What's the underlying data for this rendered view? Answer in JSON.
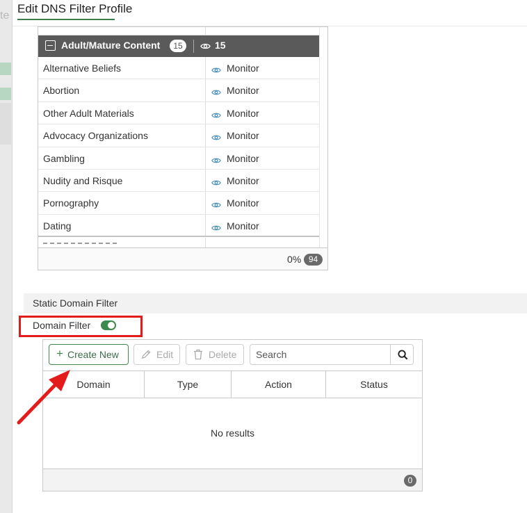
{
  "page": {
    "title": "Edit DNS Filter Profile"
  },
  "background": {
    "left_fragment": "te"
  },
  "category_table": {
    "group": {
      "label": "Adult/Mature Content",
      "badge": "15",
      "monitor_count": "15"
    },
    "rows": [
      {
        "name": "Alternative Beliefs",
        "action": "Monitor"
      },
      {
        "name": "Abortion",
        "action": "Monitor"
      },
      {
        "name": "Other Adult Materials",
        "action": "Monitor"
      },
      {
        "name": "Advocacy Organizations",
        "action": "Monitor"
      },
      {
        "name": "Gambling",
        "action": "Monitor"
      },
      {
        "name": "Nudity and Risque",
        "action": "Monitor"
      },
      {
        "name": "Pornography",
        "action": "Monitor"
      },
      {
        "name": "Dating",
        "action": "Monitor"
      }
    ],
    "footer": {
      "percent": "0%",
      "total": "94"
    }
  },
  "static_domain_filter": {
    "section_title": "Static Domain Filter",
    "toggle_label": "Domain Filter",
    "toggle_on": true,
    "toolbar": {
      "create_label": "Create New",
      "edit_label": "Edit",
      "delete_label": "Delete",
      "search_placeholder": "Search"
    },
    "columns": [
      "Domain",
      "Type",
      "Action",
      "Status"
    ],
    "empty_text": "No results",
    "count": "0"
  },
  "annotation": {
    "highlight_color": "#e41b1b"
  },
  "colors": {
    "accent": "#3d8a4e",
    "group_header": "#5a5a5a",
    "monitor_icon": "#4a90b8"
  }
}
